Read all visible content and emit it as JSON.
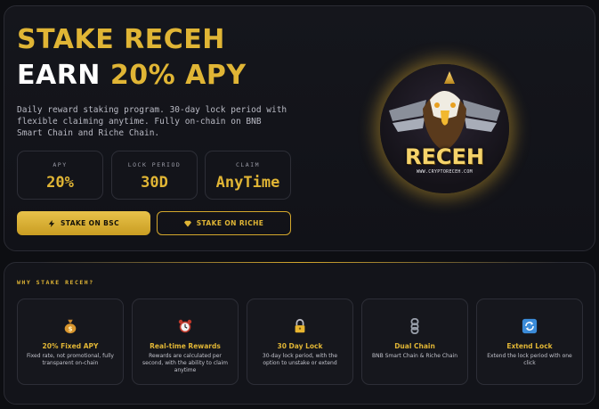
{
  "hero": {
    "title_line1": "STAKE RECEH",
    "title_line2_prefix": "EARN ",
    "title_line2_accent": "20% APY",
    "description": "Daily reward staking program. 30-day lock period with flexible claiming anytime. Fully on-chain on BNB Smart Chain and Riche Chain.",
    "stats": [
      {
        "label": "APY",
        "value": "20%"
      },
      {
        "label": "LOCK PERIOD",
        "value": "30D"
      },
      {
        "label": "CLAIM",
        "value": "AnyTime"
      }
    ],
    "buttons": {
      "bsc": {
        "label": "STAKE ON BSC",
        "icon": "lightning-icon"
      },
      "riche": {
        "label": "STAKE ON RICHE",
        "icon": "diamond-icon"
      }
    },
    "logo": {
      "text": "RECEH",
      "subtext": "WWW.CRYPTORECEH.COM"
    }
  },
  "why": {
    "label": "WHY STAKE RECEH?",
    "features": [
      {
        "icon": "money-bag-icon",
        "title": "20% Fixed APY",
        "desc": "Fixed rate, not promotional, fully transparent on-chain"
      },
      {
        "icon": "alarm-clock-icon",
        "title": "Real-time Rewards",
        "desc": "Rewards are calculated per second, with the ability to claim anytime"
      },
      {
        "icon": "lock-icon",
        "title": "30 Day Lock",
        "desc": "30-day lock period, with the option to unstake or extend"
      },
      {
        "icon": "chain-icon",
        "title": "Dual Chain",
        "desc": "BNB Smart Chain & Riche Chain"
      },
      {
        "icon": "refresh-icon",
        "title": "Extend Lock",
        "desc": "Extend the lock period with one click"
      }
    ]
  },
  "colors": {
    "accent": "#e0b535",
    "background": "#0d0e12",
    "card": "#16171d"
  }
}
